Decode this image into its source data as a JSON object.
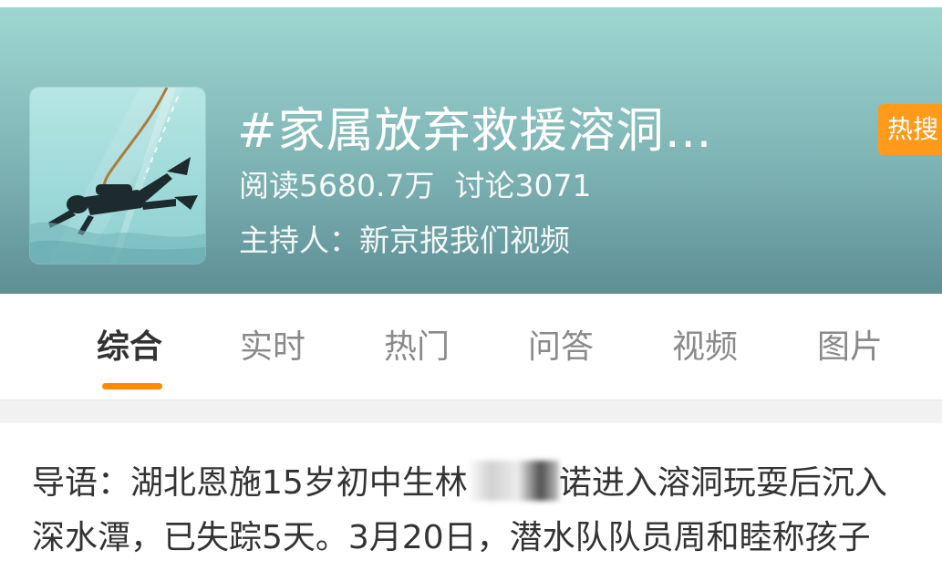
{
  "header": {
    "title": "#家属放弃救援溶洞…",
    "hot_badge": "热搜",
    "read_count": "阅读5680.7万",
    "discussion_count": "讨论3071",
    "host": "主持人：新京报我们视频",
    "colors": {
      "gradient_top": "#9fd8d3",
      "gradient_bottom": "#5d8f95",
      "badge": "#ff9a1a"
    }
  },
  "tabs": [
    {
      "label": "综合",
      "active": true
    },
    {
      "label": "实时",
      "active": false
    },
    {
      "label": "热门",
      "active": false
    },
    {
      "label": "问答",
      "active": false
    },
    {
      "label": "视频",
      "active": false
    },
    {
      "label": "图片",
      "active": false
    }
  ],
  "accent_color": "#ff8a00",
  "lead": {
    "line1_before_blur": "导语：湖北恩施15岁初中生林",
    "line1_after_blur": "诺进入溶洞玩耍后沉入",
    "line2": "深水潭，已失踪5天。3月20日，潜水队队员周和睦称孩子"
  }
}
